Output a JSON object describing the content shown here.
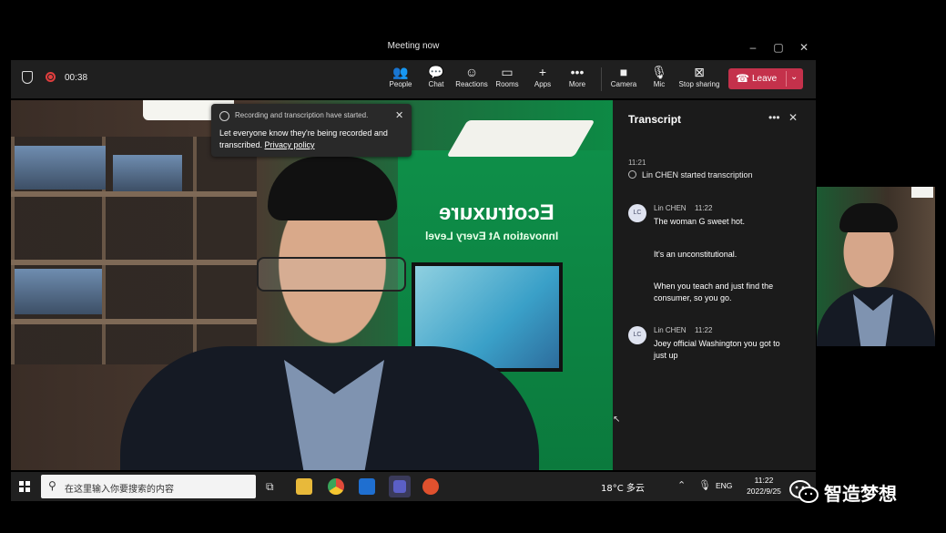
{
  "window": {
    "title": "Meeting now"
  },
  "toolbar": {
    "timer": "00:38",
    "items": [
      {
        "icon": "people-icon",
        "glyph": "👥",
        "label": "People"
      },
      {
        "icon": "chat-icon",
        "glyph": "💬",
        "label": "Chat"
      },
      {
        "icon": "reactions-icon",
        "glyph": "☺",
        "label": "Reactions"
      },
      {
        "icon": "rooms-icon",
        "glyph": "▭",
        "label": "Rooms"
      },
      {
        "icon": "apps-icon",
        "glyph": "+",
        "label": "Apps"
      },
      {
        "icon": "more-icon",
        "glyph": "•••",
        "label": "More"
      },
      {
        "icon": "camera-icon",
        "glyph": "■",
        "label": "Camera"
      },
      {
        "icon": "mic-icon",
        "glyph": "🎙",
        "label": "Mic"
      },
      {
        "icon": "share-icon",
        "glyph": "⊠",
        "label": "Stop sharing"
      }
    ],
    "leave_label": "Leave",
    "leave_color": "#c4314b"
  },
  "notice": {
    "title": "Recording and transcription have started.",
    "body": "Let everyone know they're being recorded and transcribed.",
    "link": "Privacy policy"
  },
  "video": {
    "brand": "Eco",
    "brand_suffix": "truxure",
    "tagline": "Innovation At Every Level"
  },
  "transcript": {
    "title": "Transcript",
    "system_time": "11:21",
    "system_msg": "Lin CHEN started transcription",
    "entries": [
      {
        "initials": "LC",
        "speaker": "Lin CHEN",
        "time": "11:22",
        "messages": [
          "The woman G sweet hot.",
          "It's an unconstitutional.",
          "When you teach and just find the consumer, so you go."
        ]
      },
      {
        "initials": "LC",
        "speaker": "Lin CHEN",
        "time": "11:22",
        "messages": [
          "Joey official Washington you got to just up"
        ]
      }
    ]
  },
  "taskbar": {
    "search_placeholder": "在这里输入你要搜索的内容",
    "weather": "18°C 多云",
    "lang": "ENG",
    "time": "11:22",
    "date": "2022/9/25"
  },
  "watermark": {
    "text": "智造梦想"
  }
}
